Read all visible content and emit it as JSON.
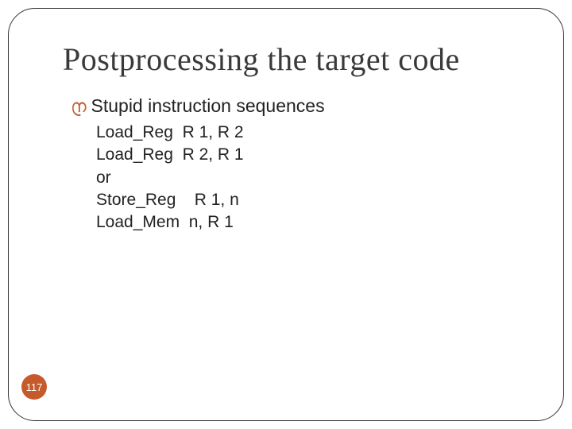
{
  "title": "Postprocessing the target code",
  "bullet": {
    "text": "Stupid instruction sequences"
  },
  "code": {
    "lines": [
      "Load_Reg  R 1, R 2",
      "Load_Reg  R 2, R 1",
      "or",
      "Store_Reg    R 1, n",
      "Load_Mem  n, R 1"
    ]
  },
  "page_number": "117"
}
